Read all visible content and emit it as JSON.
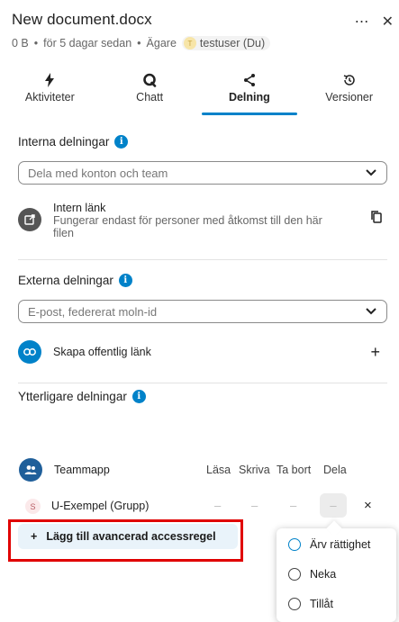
{
  "header": {
    "title": "New document.docx",
    "size": "0 B",
    "modified": "för 5 dagar sedan",
    "owner_label": "Ägare",
    "owner_initial": "T",
    "owner_name": "testuser (Du)",
    "more_icon": "more-horizontal-icon",
    "close_icon": "close-icon"
  },
  "tabs": [
    {
      "label": "Aktiviteter",
      "icon": "activity-bolt-icon"
    },
    {
      "label": "Chatt",
      "icon": "chat-icon"
    },
    {
      "label": "Delning",
      "icon": "share-icon",
      "active": true
    },
    {
      "label": "Versioner",
      "icon": "history-icon"
    }
  ],
  "internal": {
    "title": "Interna delningar",
    "select_placeholder": "Dela med konton och team",
    "link_title": "Intern länk",
    "link_desc": "Fungerar endast för personer med åtkomst till den här filen"
  },
  "external": {
    "title": "Externa delningar",
    "select_placeholder": "E-post, federerat moln-id",
    "public_link": "Skapa offentlig länk"
  },
  "additional": {
    "title": "Ytterligare delningar",
    "team_folder": "Teammapp",
    "perm_headers": [
      "Läsa",
      "Skriva",
      "Ta bort",
      "Dela"
    ],
    "group_initial": "S",
    "group_name": "U-Exempel (Grupp)",
    "perm_values": [
      "–",
      "–",
      "–",
      "–"
    ],
    "remove_symbol": "×",
    "add_rule_plus": "+",
    "add_rule_label": "Lägg till avancerad accessregel"
  },
  "popup": {
    "options": [
      "Ärv rättighet",
      "Neka",
      "Tillåt"
    ]
  },
  "colors": {
    "accent": "#0082c9",
    "highlight": "#e00000"
  }
}
